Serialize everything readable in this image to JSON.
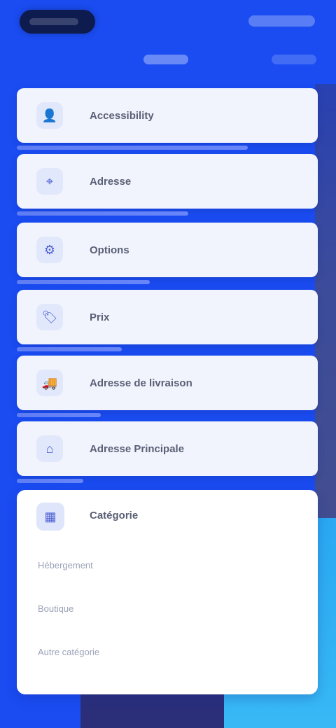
{
  "header": {
    "logo_text": "",
    "top_action": "",
    "tabs": [
      "",
      ""
    ]
  },
  "cards": [
    {
      "label": "Accessibility",
      "icon": "person-icon"
    },
    {
      "label": "Adresse",
      "icon": "location-icon"
    },
    {
      "label": "Options",
      "icon": "settings-icon"
    },
    {
      "label": "Prix",
      "icon": "tag-icon"
    },
    {
      "label": "Adresse de livraison",
      "icon": "truck-icon"
    },
    {
      "label": "Adresse Principale",
      "icon": "home-icon"
    }
  ],
  "panel": {
    "label": "Catégorie",
    "icon": "category-icon",
    "rows": [
      "Hébergement",
      "Boutique",
      "Autre catégorie"
    ]
  },
  "colors": {
    "background": "#1a4cf2",
    "card": "#f1f4fd",
    "panel": "#ffffff",
    "label": "#5a5f75",
    "muted": "#9aa2b7"
  }
}
